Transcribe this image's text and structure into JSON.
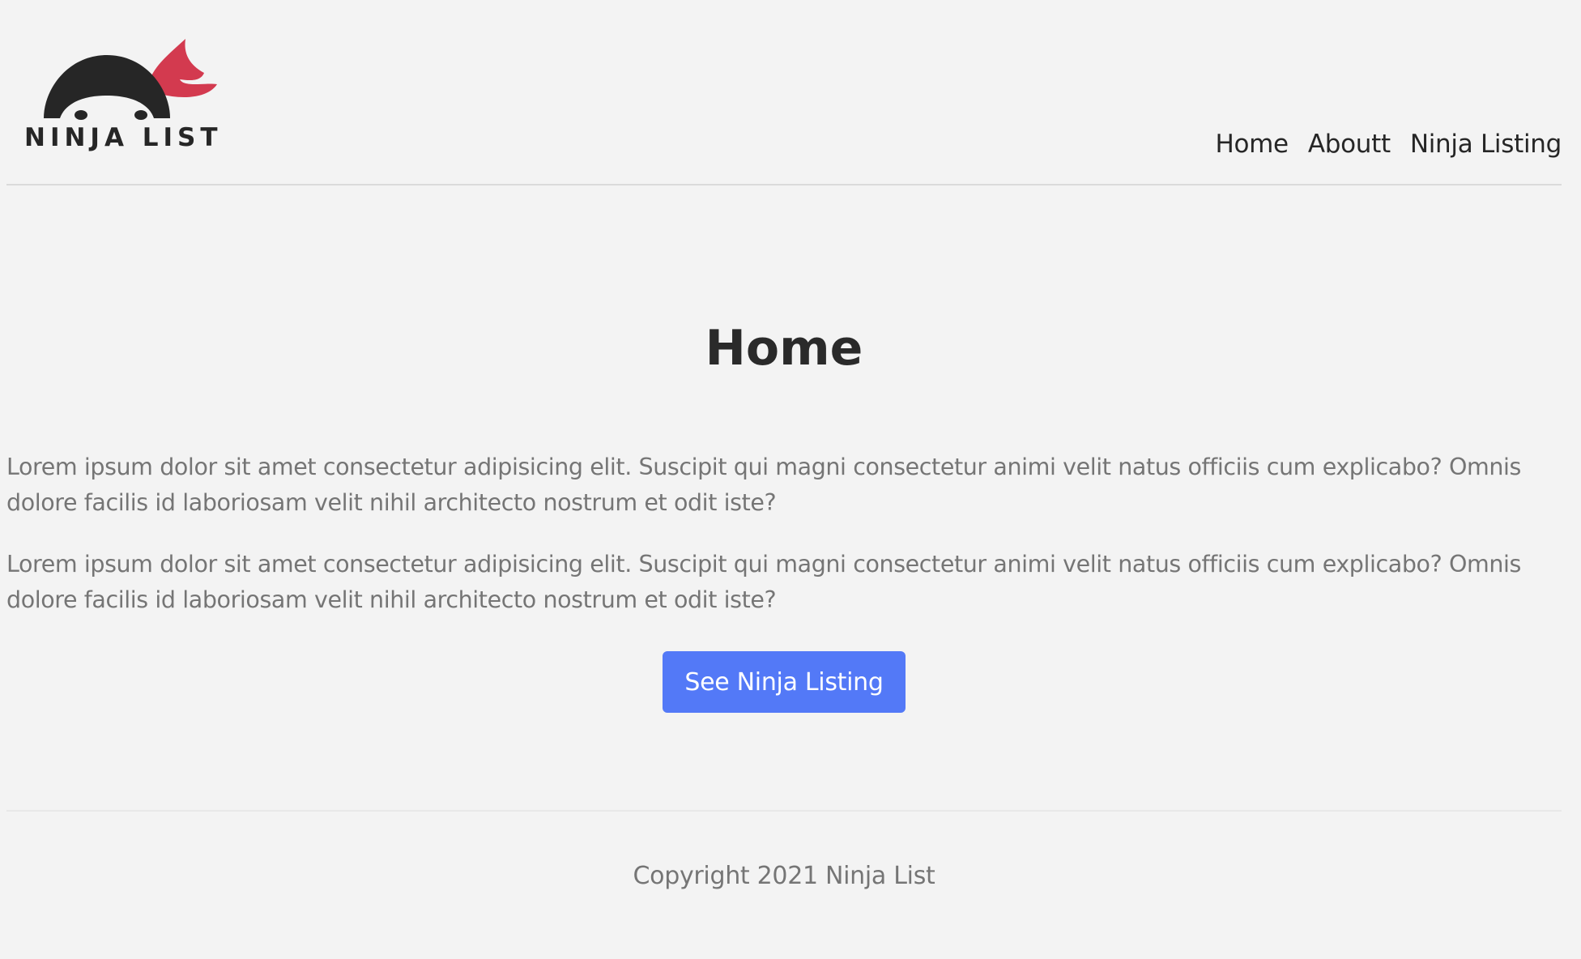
{
  "header": {
    "logo_text": "NINJA LIST",
    "nav": [
      {
        "label": "Home"
      },
      {
        "label": "Aboutt"
      },
      {
        "label": "Ninja Listing"
      }
    ]
  },
  "main": {
    "title": "Home",
    "paragraphs": [
      "Lorem ipsum dolor sit amet consectetur adipisicing elit. Suscipit qui magni consectetur animi velit natus officiis cum explicabo? Omnis dolore facilis id laboriosam velit nihil architecto nostrum et odit iste?",
      "Lorem ipsum dolor sit amet consectetur adipisicing elit. Suscipit qui magni consectetur animi velit natus officiis cum explicabo? Omnis dolore facilis id laboriosam velit nihil architecto nostrum et odit iste?"
    ],
    "button_label": "See Ninja Listing"
  },
  "footer": {
    "copyright": "Copyright 2021 Ninja List"
  },
  "colors": {
    "background": "#f3f3f3",
    "button": "#5379f7",
    "headband": "#d33a4f",
    "logo_dark": "#262626"
  }
}
